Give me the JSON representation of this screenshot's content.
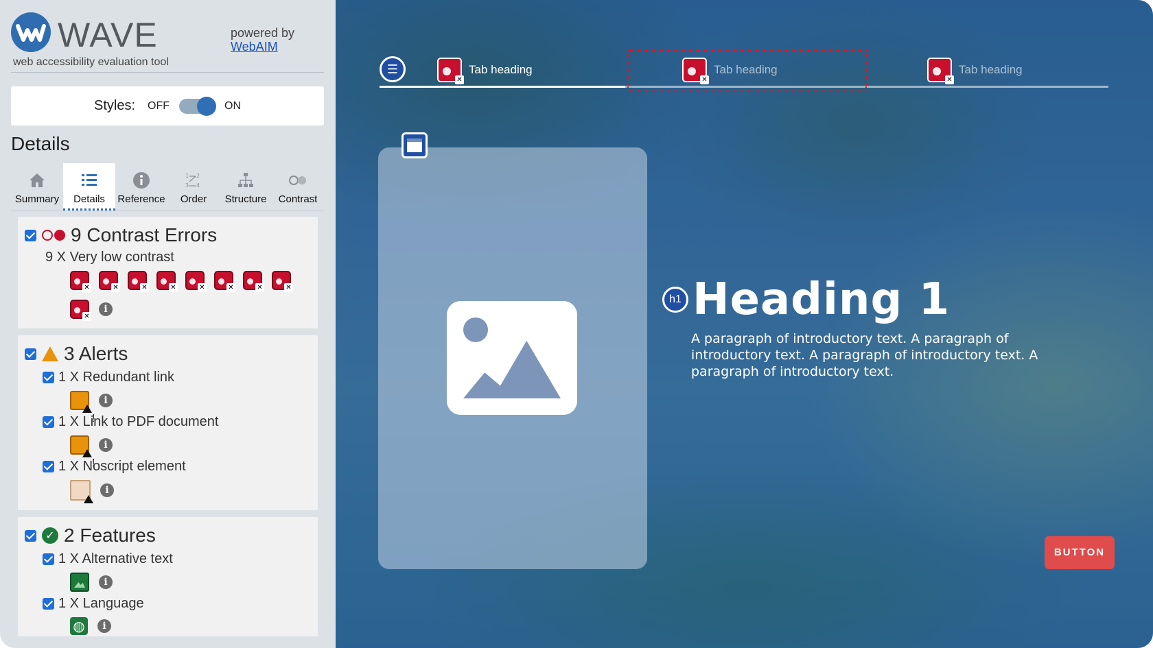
{
  "brand": {
    "name": "WAVE",
    "tagline": "web accessibility evaluation tool",
    "powered_by": "powered by",
    "powered_link": "WebAIM"
  },
  "styles_toggle": {
    "label": "Styles:",
    "off": "OFF",
    "on": "ON",
    "state": "on"
  },
  "details_title": "Details",
  "tabs": [
    {
      "label": "Summary",
      "icon": "home-icon"
    },
    {
      "label": "Details",
      "icon": "list-icon",
      "active": true
    },
    {
      "label": "Reference",
      "icon": "info-icon"
    },
    {
      "label": "Order",
      "icon": "order-icon"
    },
    {
      "label": "Structure",
      "icon": "structure-icon"
    },
    {
      "label": "Contrast",
      "icon": "contrast-icon"
    }
  ],
  "groups": {
    "contrast": {
      "heading": "9 Contrast Errors",
      "sub": "9 X Very low contrast",
      "count": 9
    },
    "alerts": {
      "heading": "3 Alerts",
      "items": [
        {
          "label": "1 X Redundant link"
        },
        {
          "label": "1 X Link to PDF document"
        },
        {
          "label": "1 X Noscript element"
        }
      ]
    },
    "features": {
      "heading": "2 Features",
      "items": [
        {
          "label": "1 X Alternative text"
        },
        {
          "label": "1 X Language"
        }
      ]
    }
  },
  "preview": {
    "tabs": [
      {
        "label": "Tab heading"
      },
      {
        "label": "Tab heading"
      },
      {
        "label": "Tab heading"
      }
    ],
    "h1_badge": "h1",
    "heading": "Heading 1",
    "intro": "A paragraph of introductory text. A paragraph of introductory text. A paragraph of introductory text. A paragraph of introductory text.",
    "button": "BUTTON"
  },
  "colors": {
    "error": "#c8102e",
    "alert": "#e8930b",
    "feature": "#1d7a3c",
    "accent": "#2e6fb5",
    "cta": "#e04b4b"
  }
}
